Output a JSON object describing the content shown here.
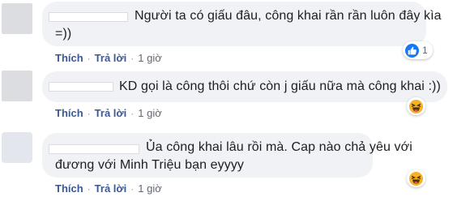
{
  "comments": [
    {
      "text_lines": [
        "Người ta có giấu đâu, công khai rần rần luôn đây kìa",
        "=))"
      ],
      "actions": {
        "like": "Thích",
        "reply": "Trả lời",
        "time": "1 giờ"
      },
      "reaction": {
        "icon": "like-icon",
        "count": "1"
      }
    },
    {
      "text_lines": [
        "KD gọi là công thôi chứ còn j giấu nữa mà công khai :))"
      ],
      "actions": {
        "like": "Thích",
        "reply": "Trả lời",
        "time": "1 giờ"
      },
      "reaction": {
        "icon": "haha-icon",
        "count": ""
      }
    },
    {
      "text_lines": [
        "Ủa công khai lâu rồi mà. Cap nào chả yêu với",
        "đương với Minh Triệu bạn eyyyy"
      ],
      "actions": {
        "like": "Thích",
        "reply": "Trả lời",
        "time": "1 giờ"
      },
      "reaction": {
        "icon": "haha-icon",
        "count": ""
      }
    }
  ],
  "separator": "·",
  "colors": {
    "bubble": "#f0f2f5",
    "link": "#385898",
    "like_blue": "#1877f2",
    "haha_yellow": "#f7b125"
  }
}
